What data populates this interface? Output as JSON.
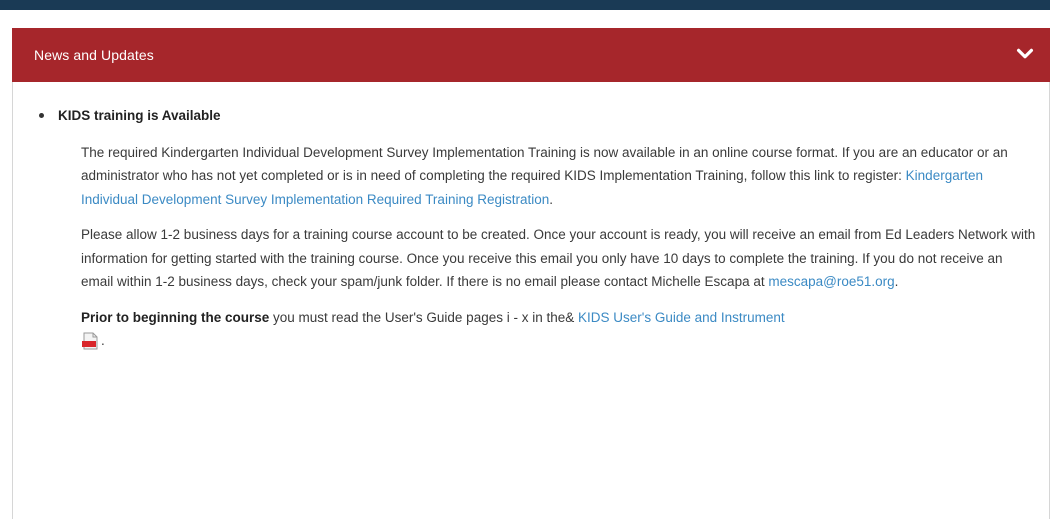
{
  "panel": {
    "title": "News and Updates",
    "toggle_icon": "chevron-down-icon"
  },
  "item": {
    "title": "KIDS training is Available",
    "p1_text": "The required Kindergarten Individual Development Survey Implementation Training is now available in an online course format. If you are an educator or an administrator who has not yet completed or is in need of completing the required KIDS Implementation Training, follow this link to register: ",
    "p1_link": "Kindergarten Individual Development Survey Implementation Required Training Registration",
    "p1_end": ".",
    "p2_text": "Please allow 1-2 business days for a training course account to be created. Once your account is ready, you will receive an email from Ed Leaders Network with information for getting started with the training course. Once you receive this email you only have 10 days to complete the training. If you do not receive an email within 1-2 business days, check your spam/junk folder. If there is no email please contact Michelle Escapa at ",
    "p2_link": "mescapa@roe51.org",
    "p2_end": ".",
    "p3_strong": "Prior to beginning the course",
    "p3_text": " you must read the User's Guide pages i - x in the& ",
    "p3_link": "KIDS User's Guide and Instrument",
    "p3_end": ".",
    "pdf_icon": "pdf-file-icon"
  }
}
